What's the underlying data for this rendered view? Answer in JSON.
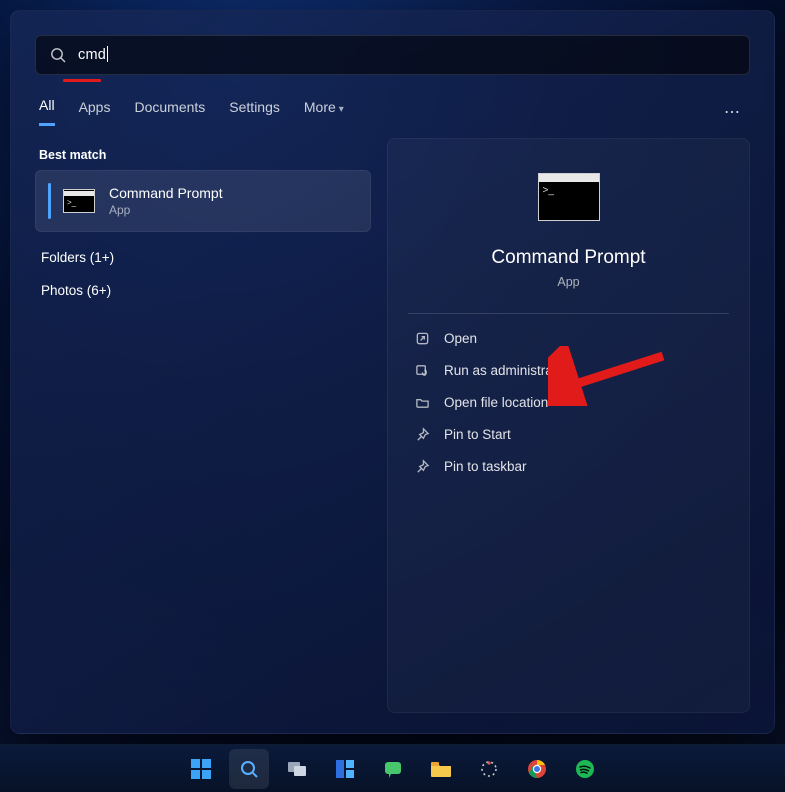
{
  "search": {
    "query": "cmd"
  },
  "tabs": {
    "all": "All",
    "apps": "Apps",
    "documents": "Documents",
    "settings": "Settings",
    "more": "More"
  },
  "left": {
    "best_match_label": "Best match",
    "result": {
      "title": "Command Prompt",
      "subtitle": "App"
    },
    "categories": {
      "folders": "Folders (1+)",
      "photos": "Photos (6+)"
    }
  },
  "preview": {
    "title": "Command Prompt",
    "subtitle": "App",
    "actions": {
      "open": "Open",
      "run_admin": "Run as administrator",
      "open_location": "Open file location",
      "pin_start": "Pin to Start",
      "pin_taskbar": "Pin to taskbar"
    }
  }
}
